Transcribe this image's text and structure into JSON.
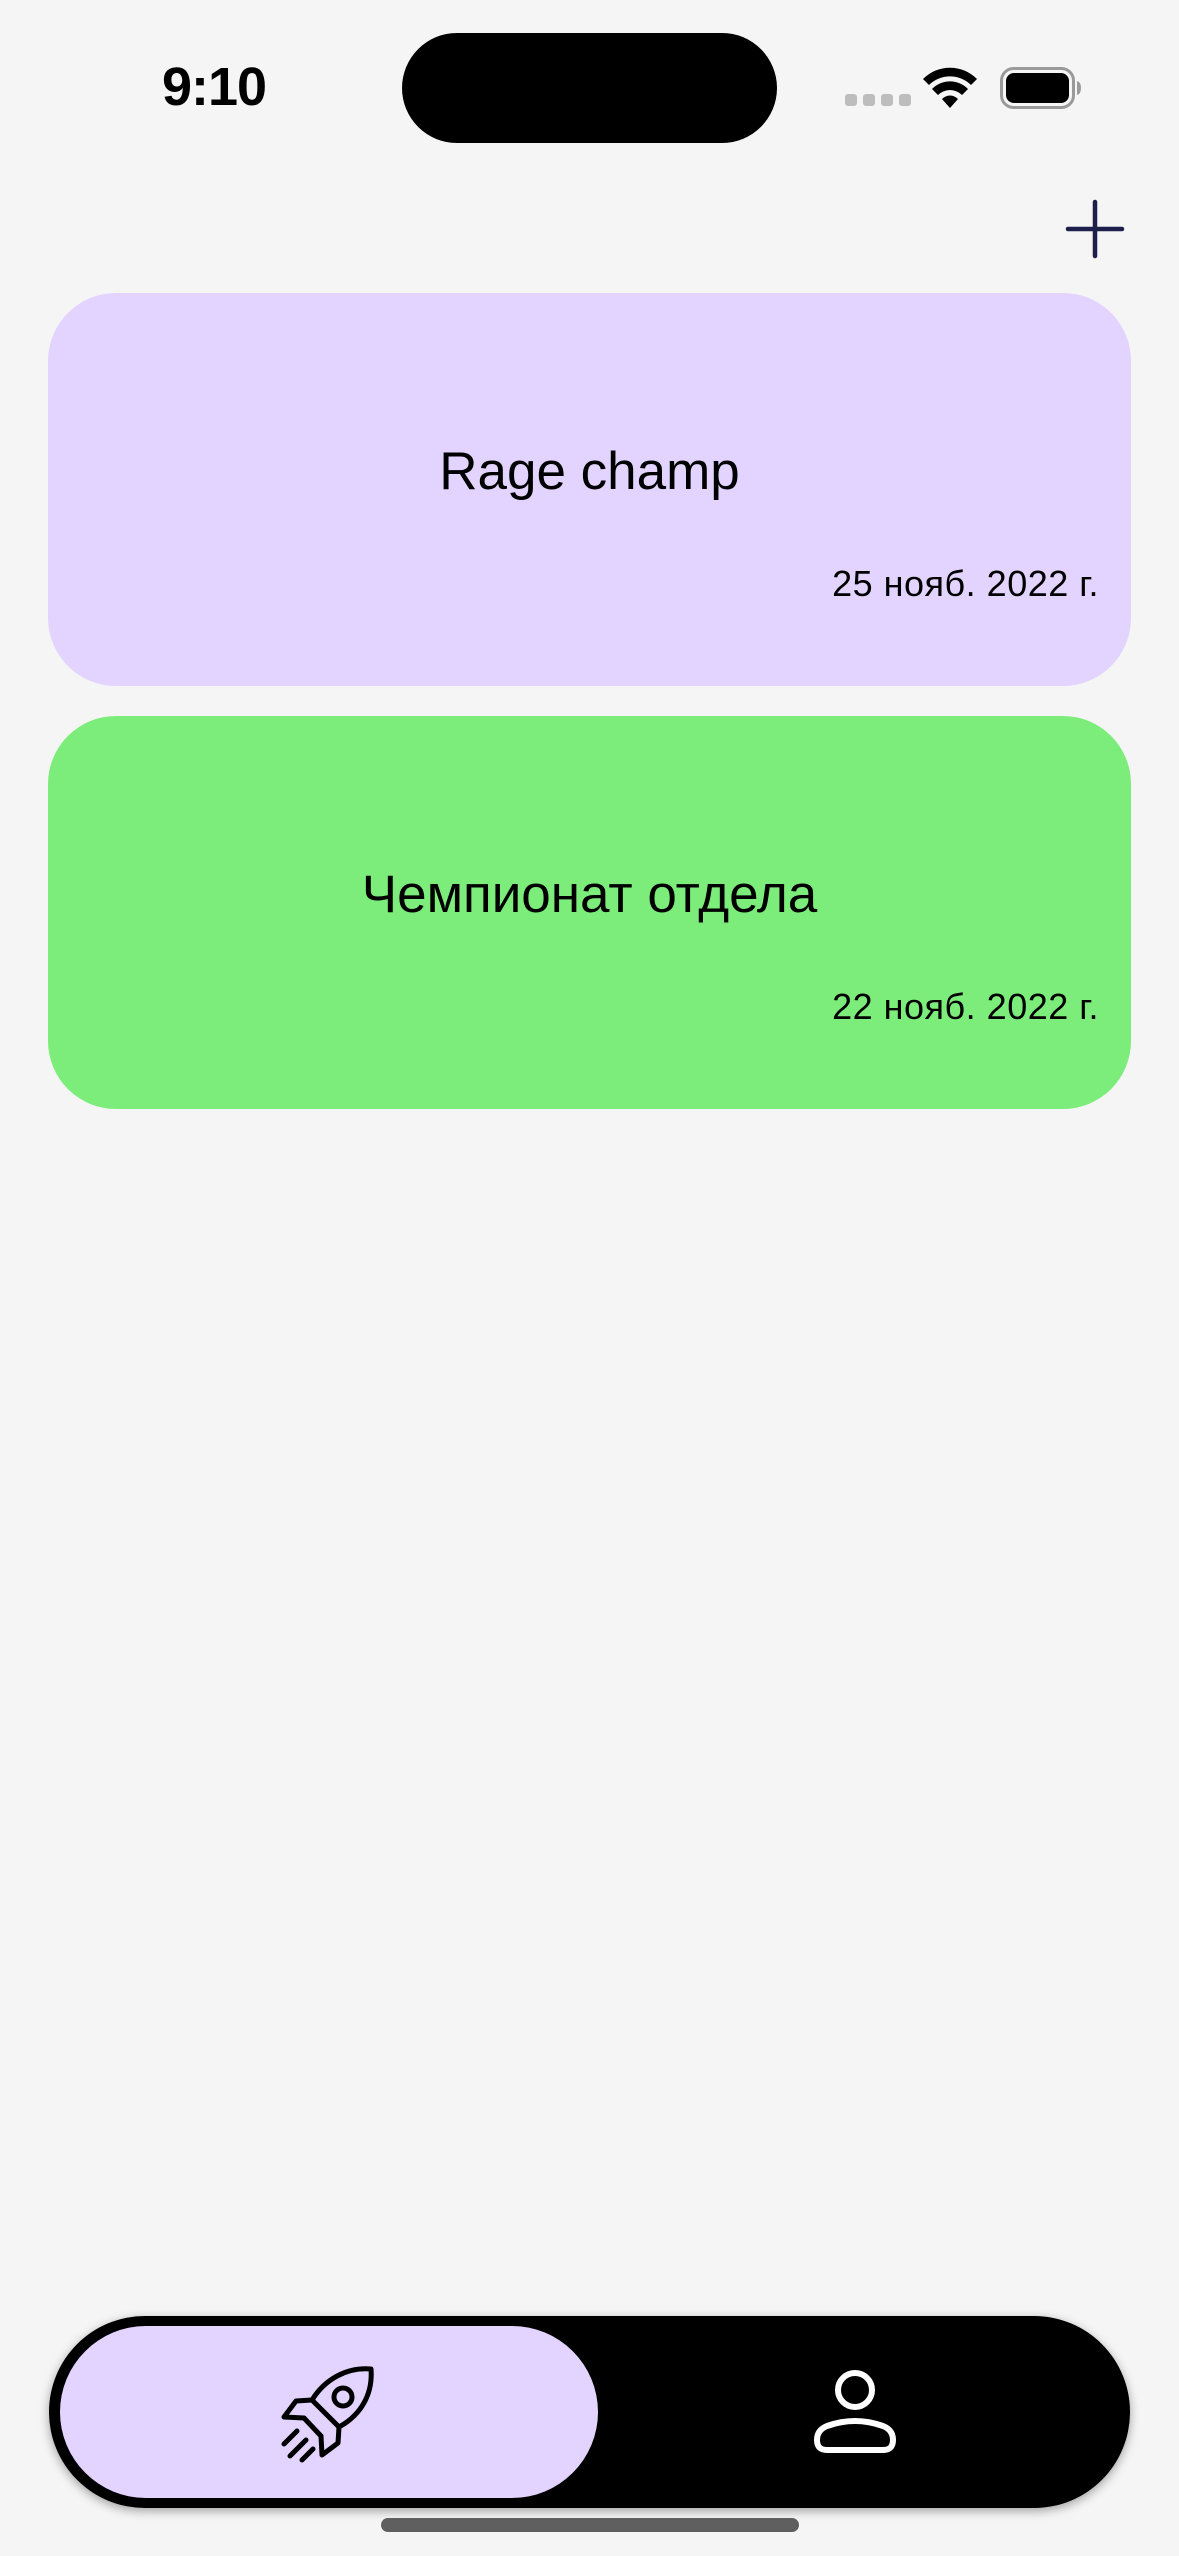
{
  "status_bar": {
    "time": "9:10"
  },
  "header": {
    "add_icon": "plus-icon"
  },
  "championships": [
    {
      "title": "Rage champ",
      "date": "25 нояб. 2022 г.",
      "color": "#e2d4ff"
    },
    {
      "title": "Чемпионат отдела",
      "date": "22 нояб. 2022 г.",
      "color": "#7ced7a"
    }
  ],
  "tab_bar": {
    "background": "#000000",
    "active_color": "#e2d4ff",
    "tabs": [
      {
        "icon": "rocket-icon",
        "active": true
      },
      {
        "icon": "person-icon",
        "active": false
      }
    ]
  }
}
